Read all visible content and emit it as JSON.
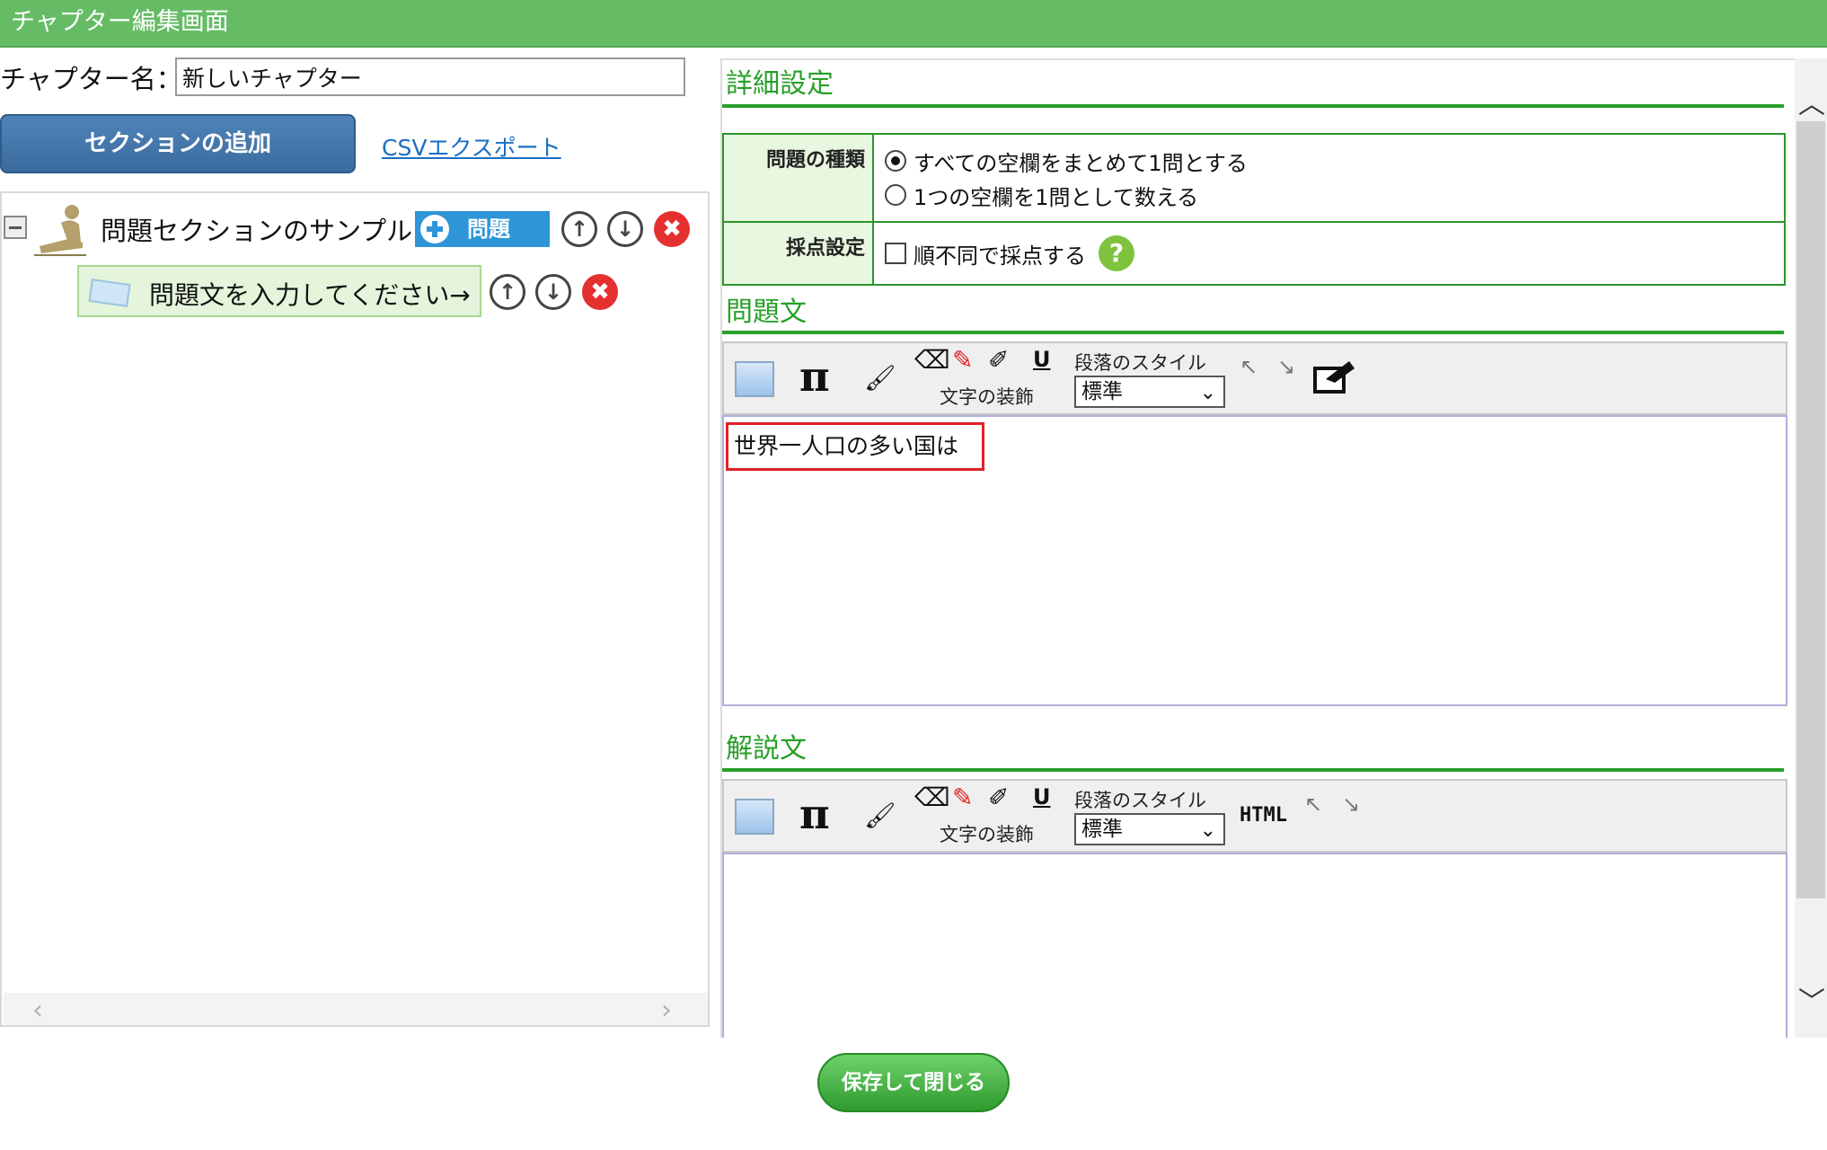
{
  "title": "チャプター編集画面",
  "chapter": {
    "label": "チャプター名：",
    "value": "新しいチャプター"
  },
  "buttons": {
    "add_section": "セクションの追加",
    "csv_export": "CSVエクスポート",
    "add_question": "問題",
    "save_close": "保存して閉じる"
  },
  "tree": {
    "section_title": "問題セクションのサンプル",
    "question_item": "問題文を入力してください→"
  },
  "icons": {
    "up": "↑",
    "down": "↓",
    "delete": "✖",
    "scroll_left": "‹",
    "scroll_right": "›",
    "scroll_up": "︿",
    "scroll_down": "﹀",
    "help": "?"
  },
  "details": {
    "heading": "詳細設定",
    "question_type_label": "問題の種類",
    "question_type_options": [
      "すべての空欄をまとめて1問とする",
      "1つの空欄を1問として数える"
    ],
    "selected_option": 0,
    "scoring_label": "採点設定",
    "scoring_checkbox": "順不同で採点する"
  },
  "question_text": {
    "heading": "問題文",
    "content": "世界一人口の多い国は"
  },
  "explanation": {
    "heading": "解説文",
    "content": ""
  },
  "toolbar": {
    "decoration_label": "文字の装飾",
    "paragraph_style_label": "段落のスタイル",
    "paragraph_style_value": "標準",
    "pi": "π",
    "underline": "U",
    "html": "HTML"
  },
  "colors": {
    "accent_green": "#28a028",
    "title_bar": "#65bc65",
    "button_blue": "#3b6c9f",
    "highlight_red": "#e0202a"
  }
}
